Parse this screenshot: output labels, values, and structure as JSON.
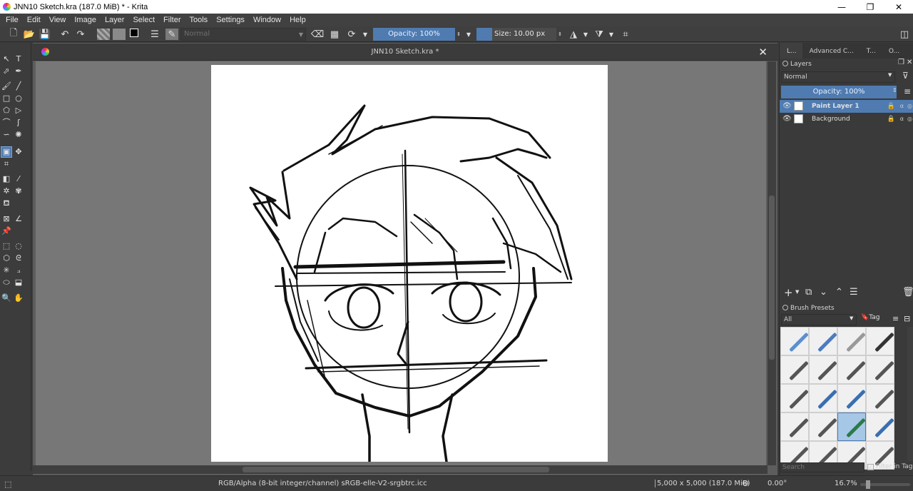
{
  "window": {
    "title": "JNN10 Sketch.kra (187.0 MiB)  * - Krita",
    "min_glyph": "—",
    "max_glyph": "❐",
    "close_glyph": "✕"
  },
  "menu": [
    "File",
    "Edit",
    "View",
    "Image",
    "Layer",
    "Select",
    "Filter",
    "Tools",
    "Settings",
    "Window",
    "Help"
  ],
  "toolbar": {
    "blend_mode": "Normal",
    "opacity_label": "Opacity: 100%",
    "size_label": "Size: 10.00 px"
  },
  "document": {
    "tab_title": "JNN10 Sketch.kra *",
    "close_glyph": "✕"
  },
  "dock": {
    "tabs": [
      "L...",
      "Advanced C...",
      "T...",
      "O..."
    ],
    "layers_title": "Layers",
    "blend_mode": "Normal",
    "opacity_label": "Opacity:  100%",
    "layers": [
      {
        "name": "Paint Layer 1",
        "selected": true
      },
      {
        "name": "Background",
        "selected": false
      }
    ],
    "brush_presets_title": "Brush Presets",
    "brush_filter": "All",
    "tag_label": "Tag",
    "search_placeholder": "Search",
    "filter_in_tag": "Filter in Tag"
  },
  "status": {
    "color_space": "RGB/Alpha (8-bit integer/channel)  sRGB-elle-V2-srgbtrc.icc",
    "image_size": "5,000 x 5,000 (187.0 MiB)",
    "rotation": "0.00°",
    "zoom": "16.7%"
  },
  "colors": {
    "accent": "#4f7bb0",
    "panel": "#3c3c3c",
    "canvas_surround": "#777777"
  }
}
